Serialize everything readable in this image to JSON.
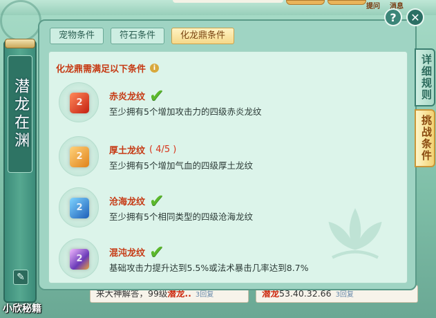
{
  "app": {
    "sidebar_title": "潜龙在渊",
    "bottom_label": "小欣秘籍"
  },
  "top": {
    "tiny_left": "提问",
    "tiny_right": "消息"
  },
  "tabs": [
    {
      "label": "宠物条件"
    },
    {
      "label": "符石条件"
    },
    {
      "label": "化龙鼎条件"
    }
  ],
  "side_tabs": [
    {
      "label": "详细规则"
    },
    {
      "label": "挑战条件"
    }
  ],
  "content": {
    "header": "化龙鼎需满足以下条件",
    "conditions": [
      {
        "title": "赤炎龙纹",
        "progress": "",
        "met": true,
        "desc": "至少拥有5个增加攻击力的四级赤炎龙纹",
        "gem_color": "#d8321c"
      },
      {
        "title": "厚土龙纹",
        "progress": "( 4/5 )",
        "met": false,
        "desc": "至少拥有5个增加气血的四级厚土龙纹",
        "gem_color": "#f0a62a"
      },
      {
        "title": "沧海龙纹",
        "progress": "",
        "met": true,
        "desc": "至少拥有5个相同类型的四级沧海龙纹",
        "gem_color": "#3c8fd8"
      },
      {
        "title": "混沌龙纹",
        "progress": "",
        "met": true,
        "desc": "基础攻击力提升达到5.5%或法术暴击几率达到8.7%",
        "gem_color": "#9d6bd4"
      }
    ]
  },
  "bottom": {
    "cell1_prefix": "来大神解答，99级",
    "cell1_red": "潜龙..",
    "cell1_reply": "3回复",
    "cell2_red": "潜龙",
    "cell2_text": "53.40.32.66",
    "cell2_reply": "3回复"
  },
  "icons": {
    "help": "?",
    "close": "✕",
    "info": "i",
    "check": "✔",
    "edit": "✎"
  }
}
